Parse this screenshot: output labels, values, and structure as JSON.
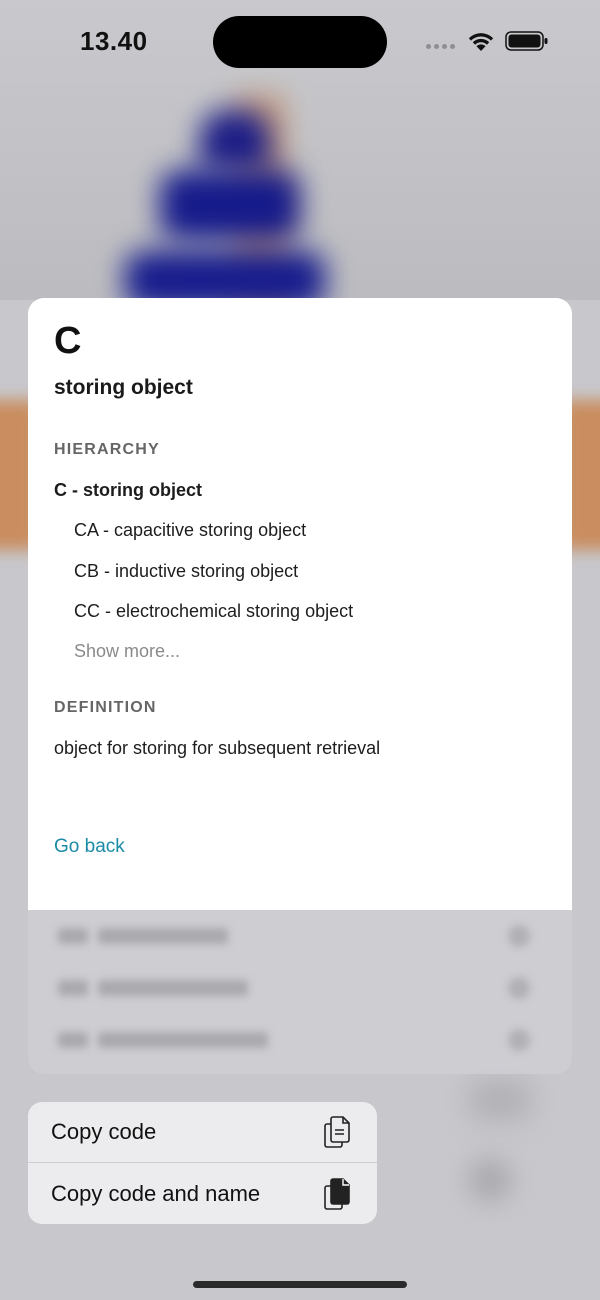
{
  "status_bar": {
    "time": "13.40",
    "wifi_icon": "wifi-icon",
    "battery_icon": "battery-icon"
  },
  "preview": {
    "code": "C",
    "name": "storing object",
    "hierarchy_label": "HIERARCHY",
    "hierarchy": {
      "root": "C - storing object",
      "children": [
        "CA - capacitive storing object",
        "CB - inductive storing object",
        "CC - electrochemical storing object"
      ],
      "show_more": "Show more..."
    },
    "definition_label": "DEFINITION",
    "definition": "object for storing for subsequent retrieval",
    "go_back": "Go back"
  },
  "context_menu": {
    "items": [
      {
        "label": "Copy code",
        "icon": "copy-document-icon"
      },
      {
        "label": "Copy code and name",
        "icon": "copy-document-filled-icon"
      }
    ]
  },
  "colors": {
    "link": "#1b8ba8",
    "section_label": "#666666",
    "show_more": "#8a8a8a"
  }
}
